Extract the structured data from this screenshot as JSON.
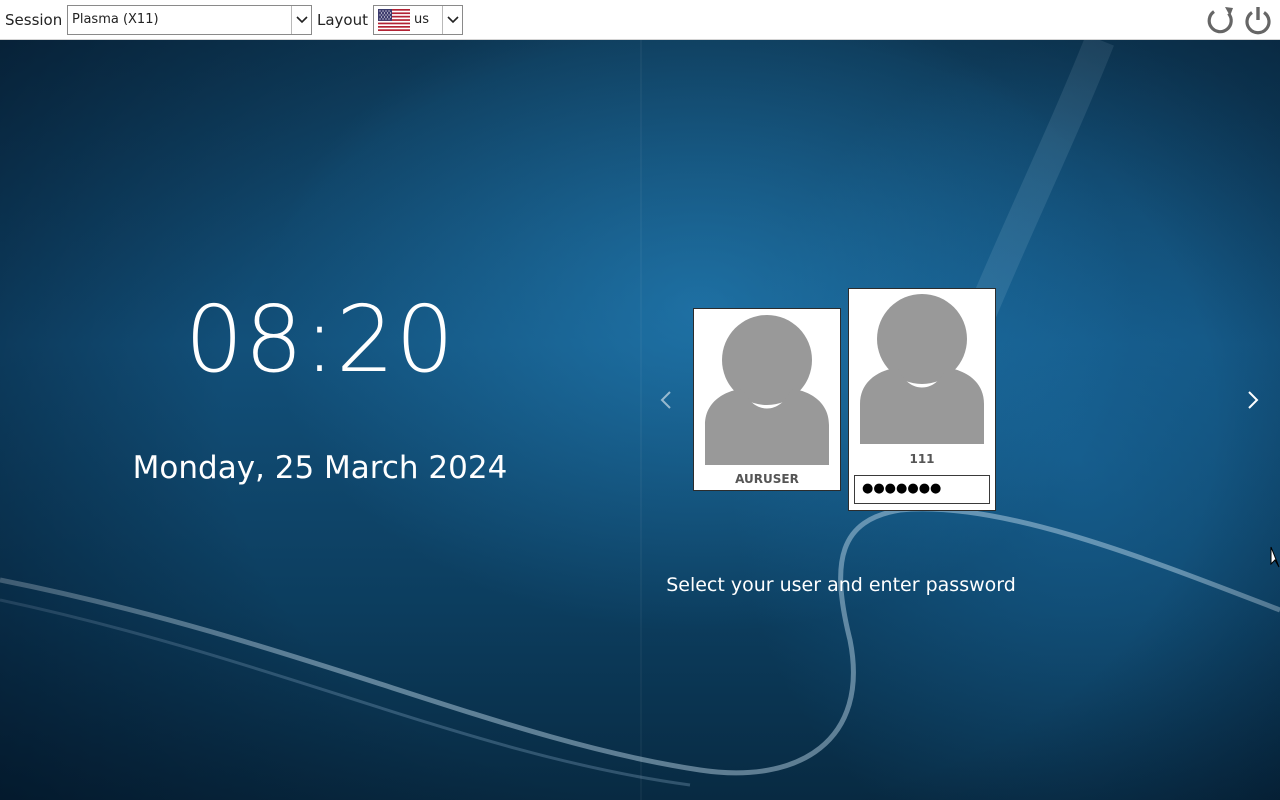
{
  "topbar": {
    "session_label": "Session",
    "session_value": "Plasma (X11)",
    "layout_label": "Layout",
    "layout_value": "us",
    "reboot_icon": "reboot-icon",
    "shutdown_icon": "power-icon"
  },
  "clock": {
    "time": "08:20",
    "date": "Monday, 25 March 2024"
  },
  "users": [
    {
      "name": "AURUSER",
      "selected": false
    },
    {
      "name": "111",
      "selected": true,
      "password_mask": "●●●●●●●"
    }
  ],
  "prompt": "Select your user and enter password",
  "colors": {
    "topbar_bg": "#ffffff",
    "text_on_desktop": "#ffffff",
    "avatar_gray": "#999999",
    "background_blue": "#12507a"
  }
}
